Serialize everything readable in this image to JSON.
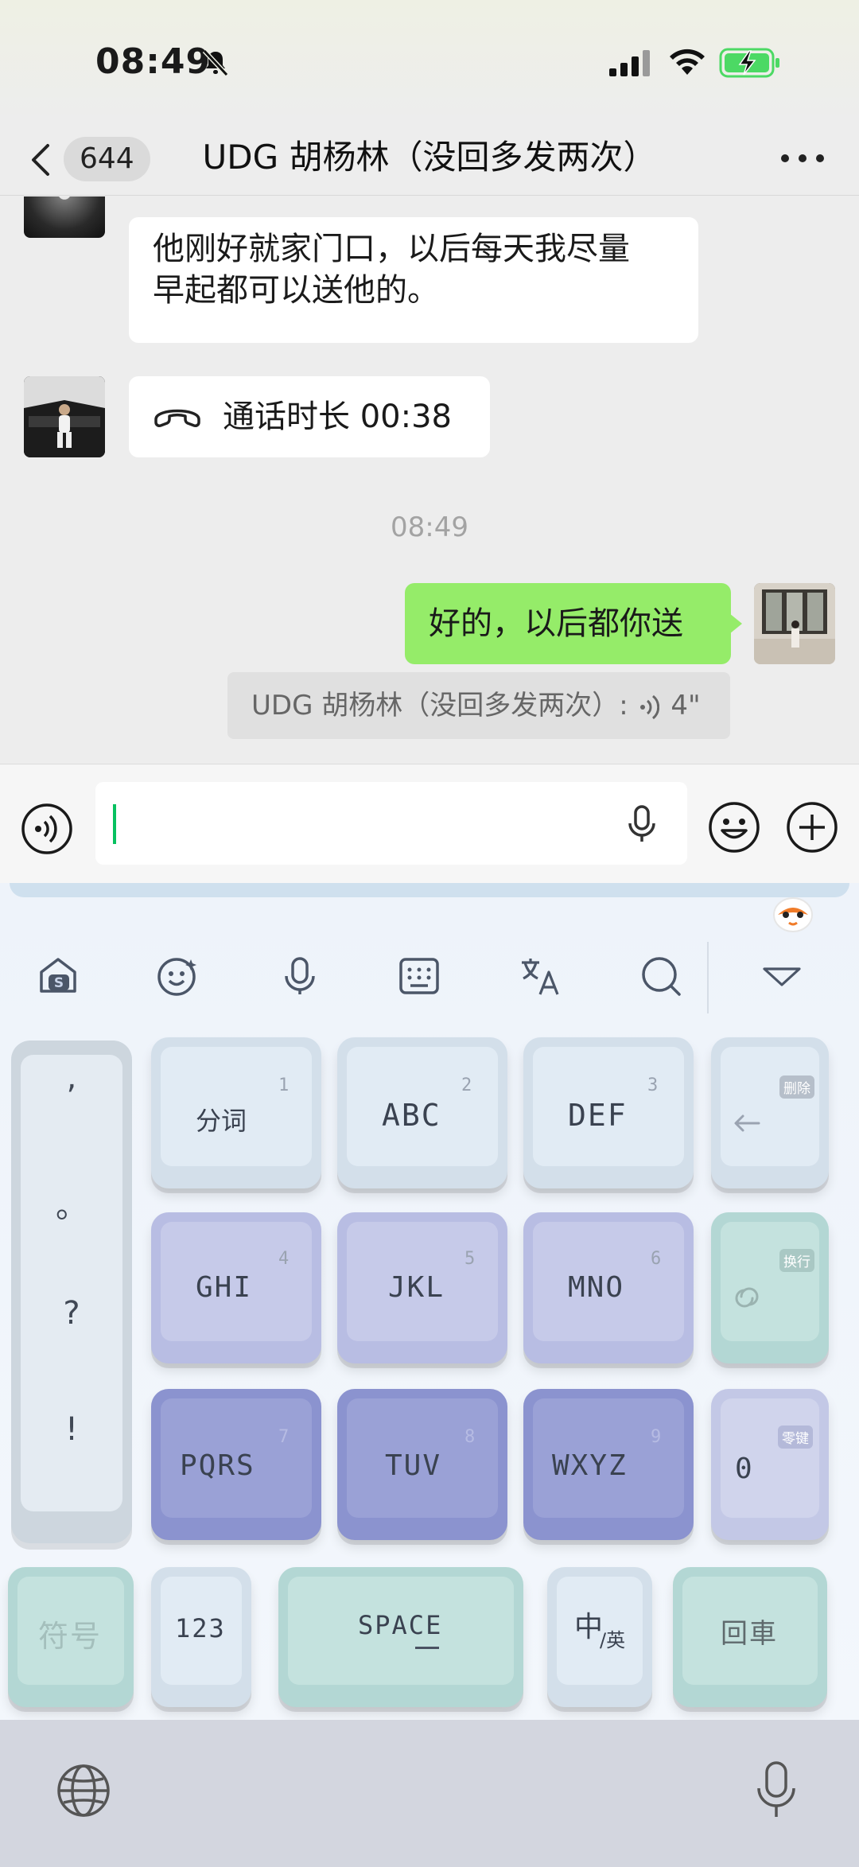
{
  "status_bar": {
    "time": "08:49"
  },
  "nav": {
    "unread_count": "644",
    "title": "UDG 胡杨林（没回多发两次）"
  },
  "messages": {
    "text_1_line1": "他刚好就家门口，以后每天我尽量",
    "text_1_line2": "早起都可以送他的。",
    "call_label": "通话时长 00:38",
    "timestamp": "08:49",
    "my_reply": "好的，以后都你送",
    "quote_prefix": "UDG 胡杨林（没回多发两次）:",
    "quote_duration": "4\""
  },
  "input": {
    "value": ""
  },
  "keyboard": {
    "keys": {
      "k1_label": "分词",
      "k1_num": "1",
      "k2_label": "ABC",
      "k2_num": "2",
      "k3_label": "DEF",
      "k3_num": "3",
      "delete_tag": "删除",
      "k4_label": "GHI",
      "k4_num": "4",
      "k5_label": "JKL",
      "k5_num": "5",
      "k6_label": "MNO",
      "k6_num": "6",
      "newline_tag": "换行",
      "k7_label": "PQRS",
      "k7_num": "7",
      "k8_label": "TUV",
      "k8_num": "8",
      "k9_label": "WXYZ",
      "k9_num": "9",
      "zero_label": "0",
      "zero_tag": "零键",
      "symbols": "符号",
      "numbers": "123",
      "space": "SPACE",
      "lang_main": "中",
      "lang_sub": "/英",
      "enter": "回車"
    },
    "punctuation": [
      ",",
      "。",
      "?",
      "!"
    ]
  },
  "colors": {
    "wechat_green_bubble": "#95ec69",
    "caret": "#07c160",
    "chat_bg": "#ededed"
  }
}
